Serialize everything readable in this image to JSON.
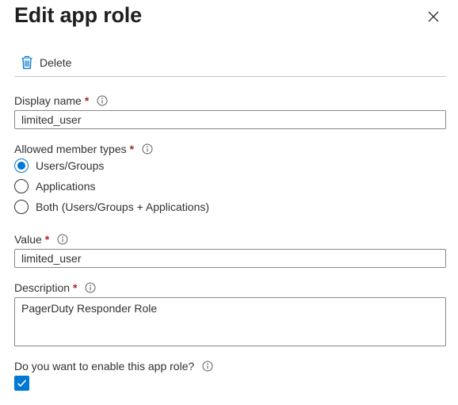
{
  "panel": {
    "title": "Edit app role",
    "close_icon": "close-icon"
  },
  "toolbar": {
    "delete_label": "Delete",
    "delete_icon": "trash-icon",
    "accent_color": "#0078d4"
  },
  "form": {
    "display_name": {
      "label": "Display name",
      "required": "*",
      "value": "limited_user"
    },
    "member_types": {
      "label": "Allowed member types",
      "required": "*",
      "options": [
        {
          "label": "Users/Groups",
          "selected": true
        },
        {
          "label": "Applications",
          "selected": false
        },
        {
          "label": "Both (Users/Groups + Applications)",
          "selected": false
        }
      ]
    },
    "value": {
      "label": "Value",
      "required": "*",
      "value": "limited_user"
    },
    "description": {
      "label": "Description",
      "required": "*",
      "value": "PagerDuty Responder Role"
    },
    "enable": {
      "label": "Do you want to enable this app role?",
      "checked": true
    }
  },
  "colors": {
    "required": "#a4262c",
    "accent": "#0078d4",
    "border": "#8a8886"
  }
}
